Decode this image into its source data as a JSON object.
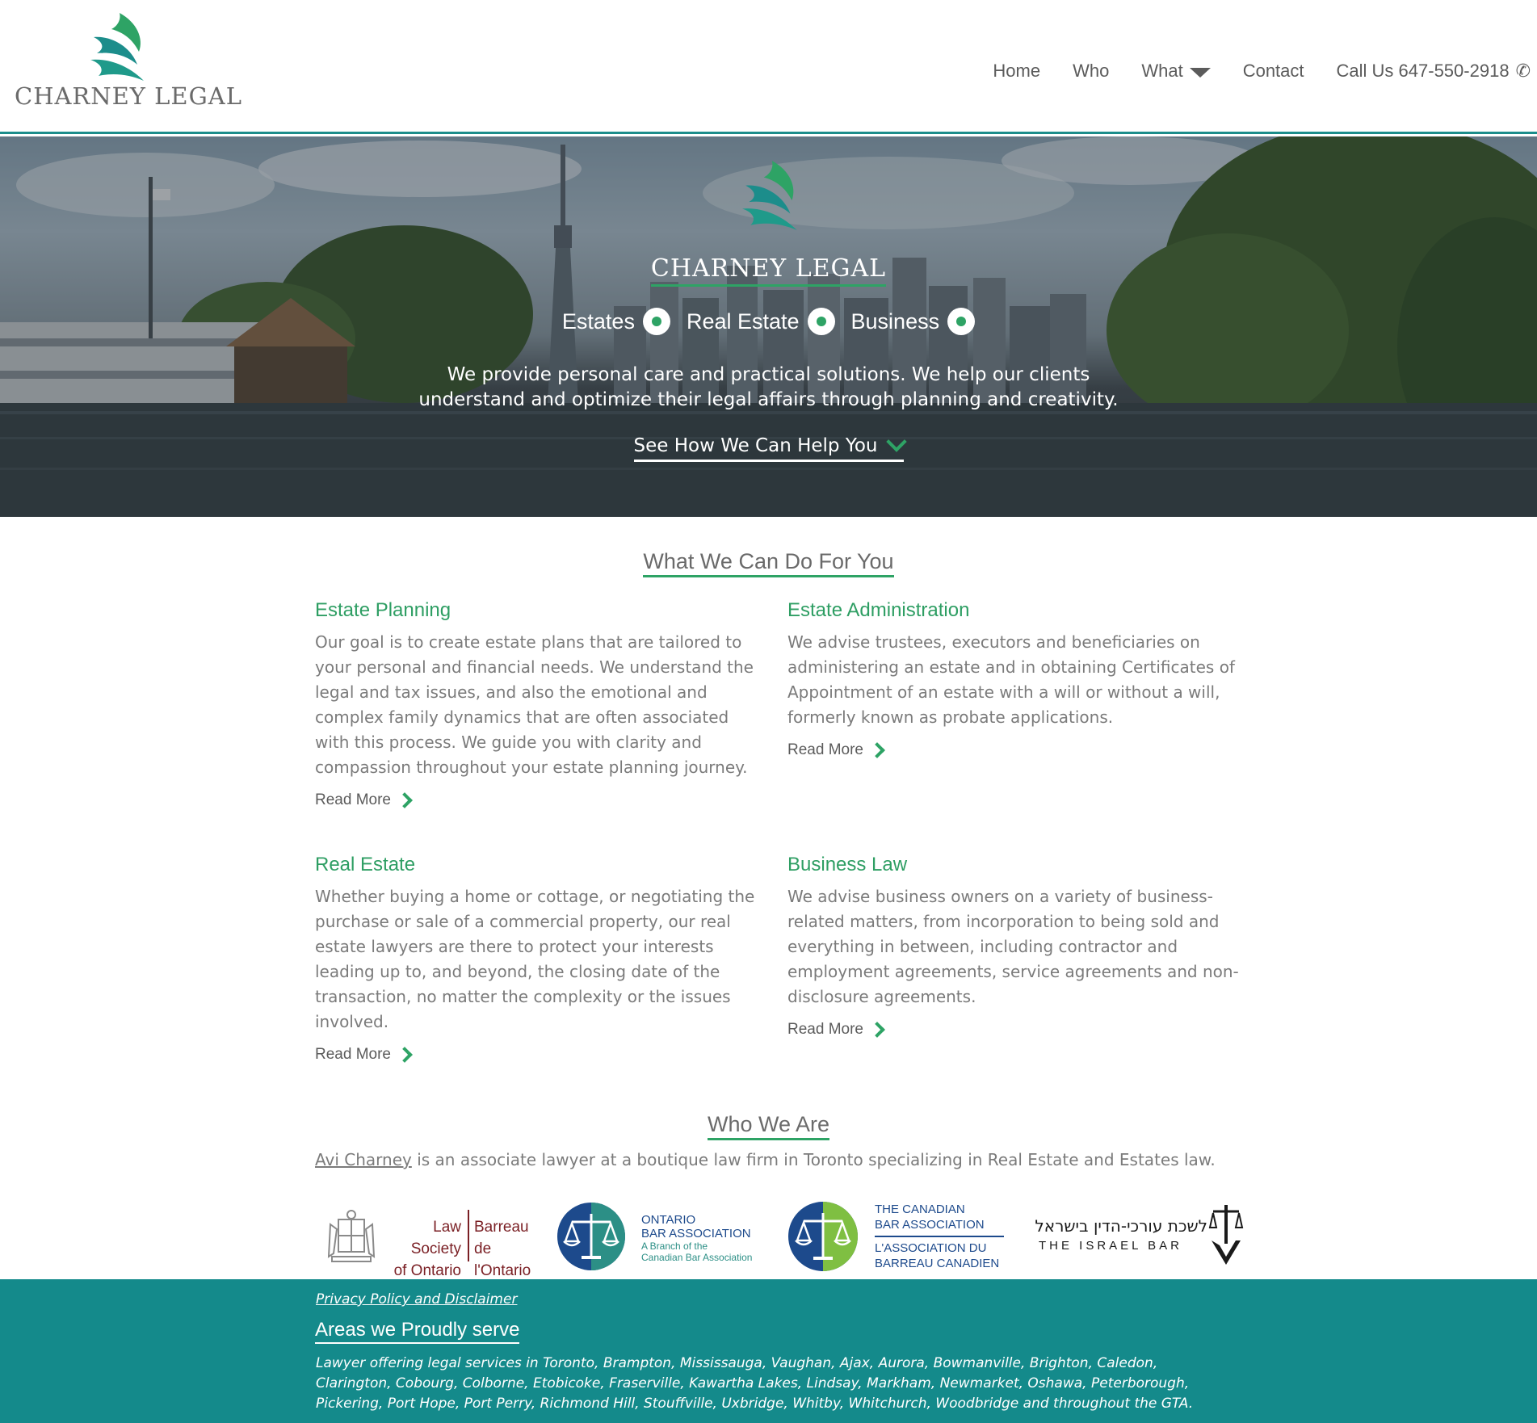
{
  "brand": {
    "name": "CHARNEY LEGAL",
    "accent": "#2ea365",
    "teal": "#148a8b"
  },
  "nav": {
    "items": [
      {
        "label": "Home"
      },
      {
        "label": "Who"
      },
      {
        "label": "What",
        "icon": "caret-down-icon"
      },
      {
        "label": "Contact"
      }
    ],
    "phone_label": "Call Us 647-550-2918",
    "phone_icon": "phone-icon"
  },
  "hero": {
    "title": "CHARNEY LEGAL",
    "services": [
      "Estates",
      "Real Estate",
      "Business"
    ],
    "tagline_line1": "We provide personal care and practical solutions. We help our clients",
    "tagline_line2": "understand and optimize their legal affairs through planning and creativity.",
    "cta": "See How We Can Help You"
  },
  "services": {
    "title": "What We Can Do For You",
    "read_more": "Read More",
    "items": [
      {
        "heading": "Estate Planning",
        "body": "Our goal is to create estate plans that are tailored to your personal and financial needs. We understand the legal and tax issues, and also the emotional and complex family dynamics that are often associated with this process. We guide you with clarity and compassion throughout your estate planning journey."
      },
      {
        "heading": "Estate Administration",
        "body": "We advise trustees, executors and beneficiaries on administering an estate and in obtaining Certificates of Appointment of an estate with a will or without a will, formerly known as probate applications."
      },
      {
        "heading": "Real Estate",
        "body": "Whether buying a home or cottage, or negotiating the purchase or sale of a commercial property, our real estate lawyers are there to protect your interests leading up to, and beyond, the closing date of the transaction, no matter the complexity or the issues involved."
      },
      {
        "heading": "Business Law",
        "body": "We advise business owners on a variety of business-related matters, from incorporation to being sold and everything in between, including contractor and employment agreements, service agreements and non-disclosure agreements."
      }
    ]
  },
  "who": {
    "title": "Who We Are",
    "link_text": "Avi Charney",
    "text": " is an associate lawyer at a boutique law firm in Toronto specializing in Real Estate and Estates law."
  },
  "affiliations": {
    "lso_en_1": "Law Society",
    "lso_en_2": "of Ontario",
    "lso_fr_1": "Barreau",
    "lso_fr_2": "de l'Ontario",
    "oba_1": "ONTARIO",
    "oba_2": "BAR ASSOCIATION",
    "oba_3": "A Branch of the",
    "oba_4": "Canadian Bar Association",
    "cba_1": "THE CANADIAN",
    "cba_2": "BAR ASSOCIATION",
    "cba_3": "L'ASSOCIATION DU",
    "cba_4": "BARREAU CANADIEN",
    "israel_he": "לשכת עורכי-הדין בישראל",
    "israel_en": "THE ISRAEL BAR"
  },
  "footer": {
    "privacy": "Privacy Policy and Disclaimer",
    "areas_title": "Areas we Proudly serve",
    "areas_text": "Lawyer offering legal services in Toronto, Brampton, Mississauga, Vaughan, Ajax, Aurora, Bowmanville, Brighton, Caledon, Clarington, Cobourg, Colborne, Etobicoke, Fraserville, Kawartha Lakes, Lindsay, Markham, Newmarket, Oshawa, Peterborough, Pickering, Port Hope, Port Perry, Richmond Hill, Stouffville, Uxbridge, Whitby, Whitchurch, Woodbridge and throughout the GTA."
  }
}
